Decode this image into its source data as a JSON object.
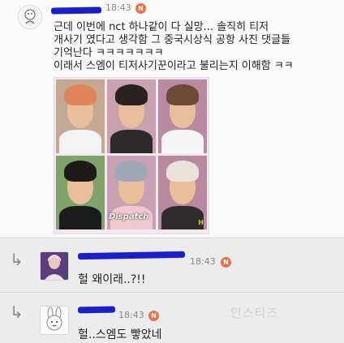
{
  "post": {
    "timestamp": "18:43",
    "badge": "N",
    "lines": [
      "근데 이번에 nct 하나같이 다 실망... 솔직히 티저",
      "개사기 였다고 생각함 그 중국시상식 공항 사진 댓글들",
      "기억난다 ㅋㅋㅋㅋㅋㅋㅋ",
      "이래서 스엠이 티저사기꾼이라고 불리는지 이해함 ㅋㅋ"
    ],
    "image": {
      "watermark": "Dispatch",
      "corner_mark": "H"
    }
  },
  "replies": [
    {
      "timestamp": "18:43",
      "badge": "N",
      "text": "헐 왜이래..?!!"
    },
    {
      "timestamp": "18:43",
      "badge": "N",
      "text": "헐..스엠도 빻았네"
    }
  ],
  "site_watermark": "인스티즈",
  "colors": {
    "badge": "#e9704a",
    "redaction": "#1b1fc8"
  }
}
